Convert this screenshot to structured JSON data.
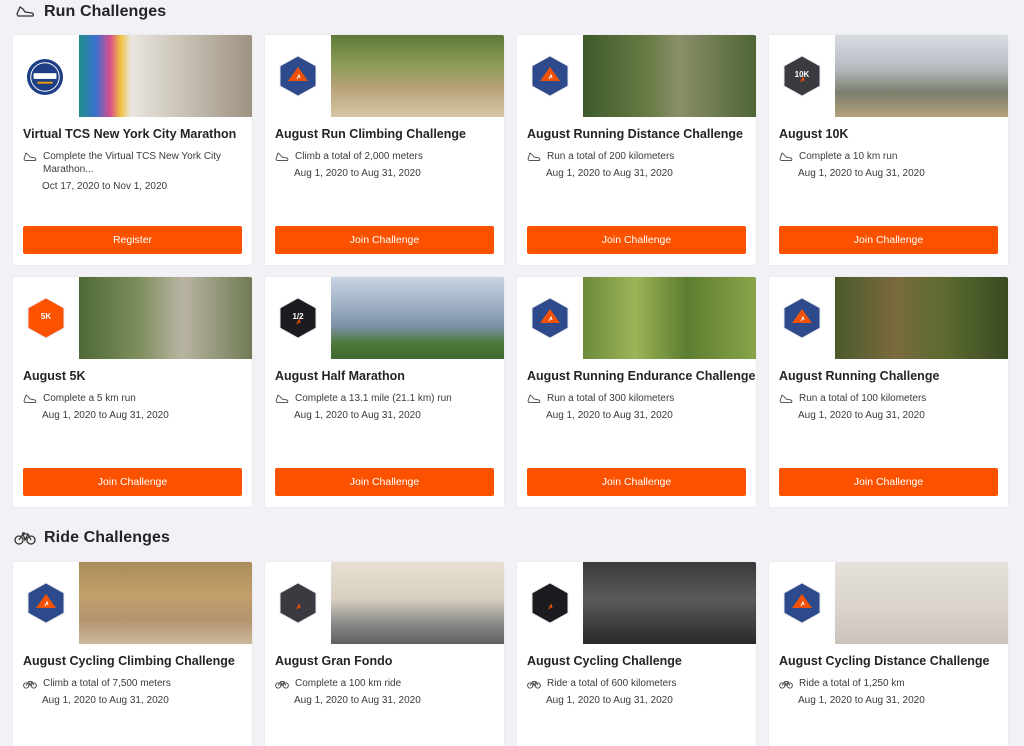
{
  "run_section": {
    "title": "Run Challenges",
    "icon": "shoe-icon"
  },
  "ride_section": {
    "title": "Ride Challenges",
    "icon": "bike-icon"
  },
  "run_challenges": [
    {
      "title": "Virtual TCS New York City Marathon",
      "desc_line1": "Complete the Virtual TCS New York City",
      "desc_line2": "Marathon...",
      "dates": "Oct 17, 2020 to Nov 1, 2020",
      "button": "Register",
      "badge": "nyc-marathon-logo",
      "badge_color": "#1e3f86",
      "photo": "marathon-runners-photo"
    },
    {
      "title": "August Run Climbing Challenge",
      "desc_line1": "Climb a total of 2,000 meters",
      "dates": "Aug 1, 2020 to Aug 31, 2020",
      "button": "Join Challenge",
      "badge": "climbing-hex-badge",
      "badge_color": "#2d4a8c",
      "photo": "trail-runners-photo"
    },
    {
      "title": "August Running Distance Challenge",
      "desc_line1": "Run a total of 200 kilometers",
      "dates": "Aug 1, 2020 to Aug 31, 2020",
      "button": "Join Challenge",
      "badge": "distance-hex-badge",
      "badge_color": "#2d4a8c",
      "photo": "forest-runner-photo"
    },
    {
      "title": "August 10K",
      "desc_line1": "Complete a 10 km run",
      "dates": "Aug 1, 2020 to Aug 31, 2020",
      "button": "Join Challenge",
      "badge": "10k-hex-badge",
      "badge_label": "10K",
      "badge_color": "#3a3a40",
      "photo": "hill-runners-photo"
    },
    {
      "title": "August 5K",
      "desc_line1": "Complete a 5 km run",
      "dates": "Aug 1, 2020 to Aug 31, 2020",
      "button": "Join Challenge",
      "badge": "5k-hex-badge",
      "badge_label": "5K",
      "badge_color": "#fc5200",
      "photo": "group-runners-photo"
    },
    {
      "title": "August Half Marathon",
      "desc_line1": "Complete a 13.1 mile (21.1 km) run",
      "dates": "Aug 1, 2020 to Aug 31, 2020",
      "button": "Join Challenge",
      "badge": "half-marathon-hex-badge",
      "badge_label": "1/2",
      "badge_color": "#1c1c20",
      "photo": "lakeside-runners-photo"
    },
    {
      "title": "August Running Endurance Challenge",
      "desc_line1": "Run a total of 300 kilometers",
      "dates": "Aug 1, 2020 to Aug 31, 2020",
      "button": "Join Challenge",
      "badge": "endurance-hex-badge",
      "badge_color": "#2d4a8c",
      "photo": "bamboo-runners-photo"
    },
    {
      "title": "August Running Challenge",
      "desc_line1": "Run a total of 100 kilometers",
      "dates": "Aug 1, 2020 to Aug 31, 2020",
      "button": "Join Challenge",
      "badge": "running-hex-badge",
      "badge_color": "#2d4a8c",
      "photo": "woods-runner-photo"
    }
  ],
  "ride_challenges": [
    {
      "title": "August Cycling Climbing Challenge",
      "desc_line1": "Climb a total of 7,500 meters",
      "dates": "Aug 1, 2020 to Aug 31, 2020",
      "badge": "cycling-climb-hex-badge",
      "badge_color": "#2d4a8c",
      "photo": "gravel-cyclist-photo"
    },
    {
      "title": "August Gran Fondo",
      "desc_line1": "Complete a 100 km ride",
      "dates": "Aug 1, 2020 to Aug 31, 2020",
      "badge": "gran-fondo-hex-badge",
      "badge_color": "#3a3a40",
      "photo": "road-cyclists-photo"
    },
    {
      "title": "August Cycling Challenge",
      "desc_line1": "Ride a total of 600 kilometers",
      "dates": "Aug 1, 2020 to Aug 31, 2020",
      "badge": "cycling-hex-badge",
      "badge_color": "#1c1c20",
      "photo": "cycling-shoes-photo"
    },
    {
      "title": "August Cycling Distance Challenge",
      "desc_line1": "Ride a total of 1,250 km",
      "dates": "Aug 1, 2020 to Aug 31, 2020",
      "badge": "cycling-distance-hex-badge",
      "badge_color": "#2d4a8c",
      "photo": "wall-cyclist-photo"
    }
  ],
  "colors": {
    "accent": "#fc5200",
    "background": "#f2f2f6",
    "text": "#242428"
  }
}
